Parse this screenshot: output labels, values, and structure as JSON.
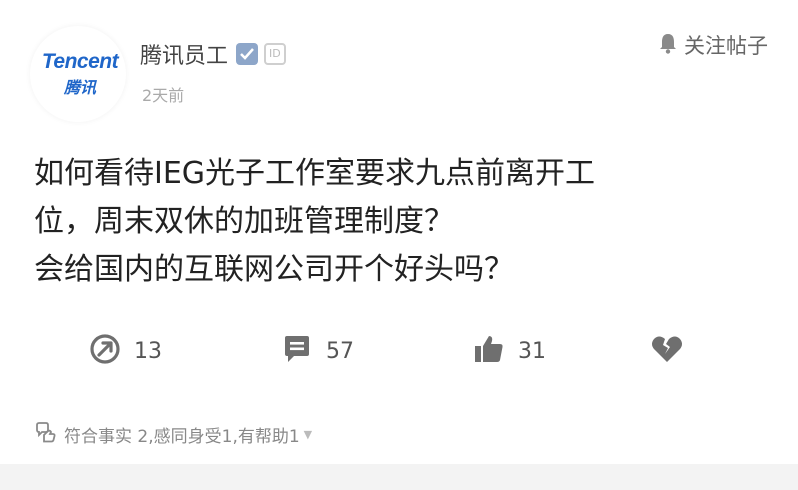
{
  "author": {
    "logo_en": "Tencent",
    "logo_cn": "腾讯",
    "name": "腾讯员工",
    "id_badge": "ID",
    "time": "2天前"
  },
  "follow": {
    "label": "关注帖子",
    "icon": "bell-icon"
  },
  "question": {
    "lines": [
      "如何看待IEG光子工作室要求九点前离开工",
      "位，周末双休的加班管理制度？",
      "会给国内的互联网公司开个好头吗？"
    ]
  },
  "actions": {
    "share": {
      "icon": "share-icon",
      "count": "13"
    },
    "comment": {
      "icon": "comment-icon",
      "count": "57"
    },
    "like": {
      "icon": "thumbs-up-icon",
      "count": "31"
    },
    "dislike": {
      "icon": "broken-heart-icon"
    }
  },
  "reactions": {
    "icon": "reaction-icon",
    "text": "符合事实 2,感同身受1,有帮助1"
  },
  "colors": {
    "brand": "#1f66c9",
    "muted": "#888888"
  }
}
